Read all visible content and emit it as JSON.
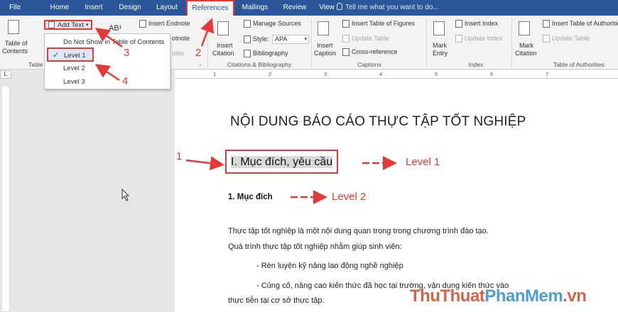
{
  "menubar": {
    "items": [
      "File",
      "Home",
      "Insert",
      "Design",
      "Layout",
      "References",
      "Mailings",
      "Review",
      "View"
    ],
    "tell_me": "Tell me what you want to do..."
  },
  "ribbon": {
    "toc": {
      "label_line1": "Table of",
      "label_line2": "Contents",
      "group": "Table"
    },
    "add_text": "Add Text",
    "insert_endnote": "Insert Endnote",
    "next_footnote": "otnote",
    "show_notes": "otes",
    "footnote_marker": "AB¹",
    "citation": {
      "insert_line1": "Insert",
      "insert_line2": "Citation",
      "manage_sources": "Manage Sources",
      "style_label": "Style:",
      "style_value": "APA",
      "bibliography": "Bibliography",
      "group": "Citations & Bibliography"
    },
    "captions": {
      "insert_line1": "Insert",
      "insert_line2": "Caption",
      "insert_table_of_figures": "Insert Table of Figures",
      "update_table": "Update Table",
      "cross_reference": "Cross-reference",
      "group": "Captions"
    },
    "index": {
      "mark_line1": "Mark",
      "mark_line2": "Entry",
      "insert_index": "Insert Index",
      "update_index": "Update Index",
      "group": "Index"
    },
    "authorities": {
      "mark_line1": "Mark",
      "mark_line2": "Citation",
      "insert_table": "Insert Table of Authorities",
      "update_table": "Update Table",
      "group": "Table of Authorities"
    }
  },
  "dropdown": {
    "items": [
      "Do Not Show in Table of Contents",
      "Level 1",
      "Level 2",
      "Level 3"
    ],
    "selected_index": 1
  },
  "ruler": {
    "numbers": [
      "1",
      "2",
      "3",
      "4",
      "5",
      "6",
      "7"
    ],
    "corner": "L"
  },
  "document": {
    "title": "NỘI DUNG BÁO CÁO THỰC TẬP TỐT NGHIỆP",
    "heading1": "I. Mục đích, yêu cầu",
    "heading2": "1. Mục đích",
    "level1_label": "Level 1",
    "level2_label": "Level 2",
    "para1_line1": "Thực tập tốt nghiệp là một nội dung quan trọng trong chương trình đào tạo.",
    "para1_line2": "Quá trình thực tập tốt nghiệp nhằm giúp sinh viên:",
    "bullet1": "- Rèn luyện kỹ năng lao động nghề nghiệp",
    "bullet2_line1": "- Củng cố, nâng cao kiến thức đã học tại trường, vận dụng kiến thức vào",
    "bullet2_line2": "thực tiễn tại cơ sở thực tập."
  },
  "annotations": [
    "1",
    "2",
    "3",
    "4"
  ],
  "watermark": {
    "part1": "ThuThuat",
    "part2": "PhanMem",
    "part3": ".vn"
  },
  "colors": {
    "word_blue": "#2b579a",
    "annotation_red": "#e53935"
  }
}
